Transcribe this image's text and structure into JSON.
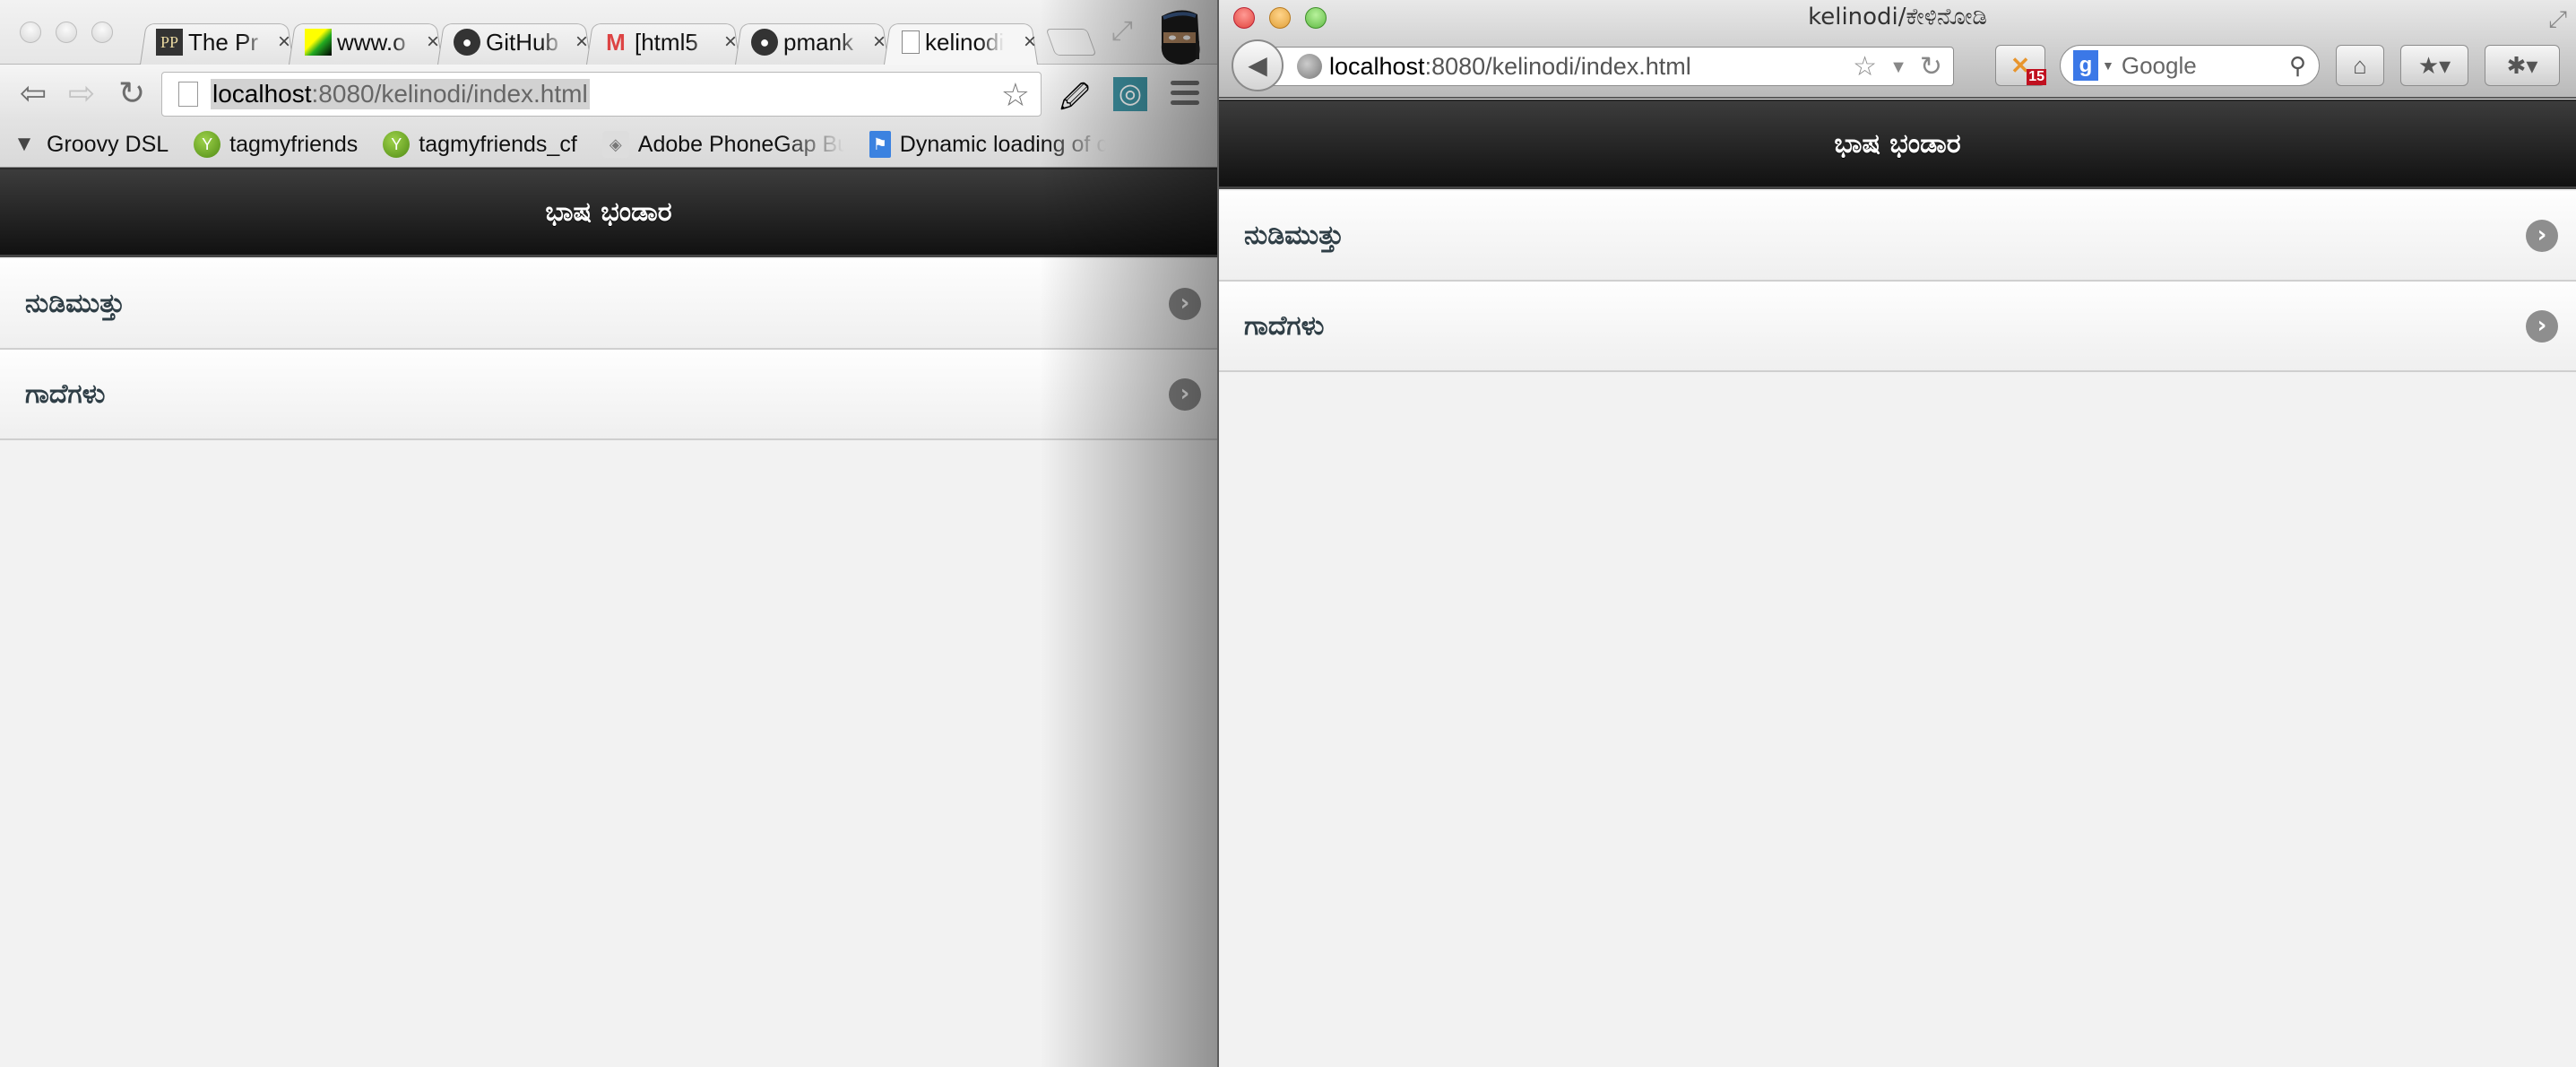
{
  "chrome": {
    "tabs": [
      {
        "title": "The Pr",
        "icon": "pp-logo-icon",
        "active": false
      },
      {
        "title": "www.o",
        "icon": "pixel-art-icon",
        "active": false
      },
      {
        "title": "GitHub",
        "icon": "github-icon",
        "active": false
      },
      {
        "title": "[html5",
        "icon": "gmail-icon",
        "active": false
      },
      {
        "title": "pmank",
        "icon": "github-icon",
        "active": false
      },
      {
        "title": "kelinodi",
        "icon": "page-icon",
        "active": true
      }
    ],
    "close_glyph": "×",
    "url_host": "localhost",
    "url_rest": ":8080/kelinodi/index.html",
    "bookmarks": [
      {
        "label": "Groovy DSL",
        "icon": "funnel-icon"
      },
      {
        "label": "tagmyfriends",
        "icon": "tagmyfriends-icon"
      },
      {
        "label": "tagmyfriends_cf",
        "icon": "tagmyfriends-icon"
      },
      {
        "label": "Adobe PhoneGap Bui",
        "icon": "phonegap-icon"
      },
      {
        "label": "Dynamic loading of c",
        "icon": "bookmark-flag-icon"
      }
    ]
  },
  "firefox": {
    "window_title": "kelinodi/ಕೇಳಿನೋಡಿ",
    "url_host": "localhost",
    "url_rest": ":8080/kelinodi/index.html",
    "search_placeholder": "Google",
    "addon_badge": "15",
    "traffic_colors": [
      "#e0443e",
      "#e0a03a",
      "#5fb943"
    ]
  },
  "page": {
    "header_title": "ಭಾಷ ಭಂಡಾರ",
    "items": [
      {
        "label": "ನುಡಿಮುತ್ತು"
      },
      {
        "label": "ಗಾದೆಗಳು"
      }
    ],
    "chevron_glyph": "›"
  }
}
